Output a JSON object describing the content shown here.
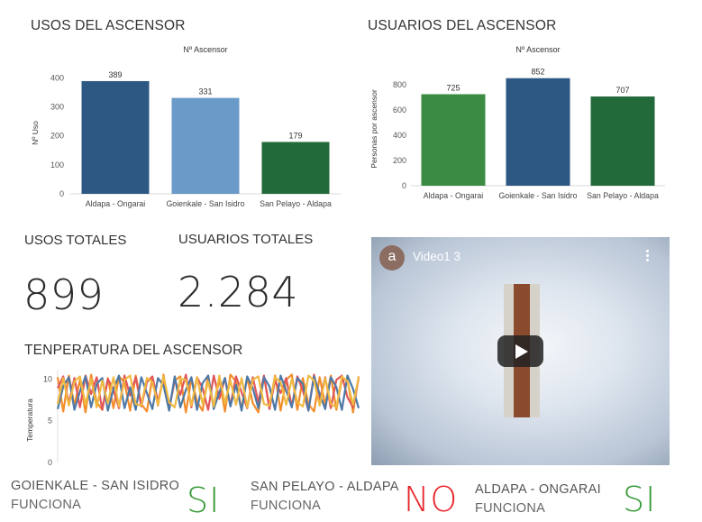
{
  "usos_chart": {
    "title": "USOS DEL ASCENSOR",
    "chart_data": {
      "type": "bar",
      "legend_title": "Nº Ascensor",
      "ylabel": "Nº Uso",
      "xlabel": "",
      "categories": [
        "Aldapa - Ongarai",
        "Goienkale - San Isidro",
        "San Pelayo - Aldapa"
      ],
      "values": [
        389,
        331,
        179
      ],
      "colors": [
        "#2d5883",
        "#6a9bc8",
        "#236a3a"
      ],
      "yticks": [
        0,
        100,
        200,
        300,
        400
      ],
      "ylim": [
        0,
        420
      ],
      "grid": false
    }
  },
  "usuarios_chart": {
    "title": "USUARIOS DEL ASCENSOR",
    "chart_data": {
      "type": "bar",
      "legend_title": "Nº Ascensor",
      "ylabel": "Personas por ascensor",
      "xlabel": "",
      "categories": [
        "Aldapa - Ongarai",
        "Goienkale - San Isidro",
        "San Pelayo - Aldapa"
      ],
      "values": [
        725,
        852,
        707
      ],
      "colors": [
        "#3b8b45",
        "#2d5883",
        "#236a3a"
      ],
      "yticks": [
        0,
        200,
        400,
        600,
        800
      ],
      "ylim": [
        0,
        900
      ],
      "grid": false
    }
  },
  "kpis": {
    "usos_totales": {
      "label": "USOS TOTALES",
      "value": "899"
    },
    "usuarios_totales": {
      "label": "USUARIOS TOTALES",
      "value": "2.284"
    }
  },
  "temp_chart": {
    "title": "TENPERATURA DEL ASCENSOR",
    "chart_data": {
      "type": "line",
      "ylabel": "Temperatura",
      "yticks": [
        0,
        5,
        10
      ],
      "ylim": [
        0,
        11
      ],
      "series": [
        {
          "color": "#f28e2b",
          "values": [
            10.2,
            6.1,
            10.4,
            6.8,
            9.9,
            6.0,
            10.5,
            7.2,
            6.3,
            10.1,
            6.5,
            10.3,
            9.6,
            6.2,
            10.4,
            7.0,
            6.1,
            10.2,
            6.8,
            10.5,
            6.4,
            9.8,
            10.3,
            6.0,
            10.1,
            7.3,
            6.2,
            10.4,
            6.6,
            10.0,
            6.1,
            10.5,
            9.7,
            6.4,
            10.2,
            7.1,
            6.0,
            10.3,
            6.7,
            10.4,
            6.2,
            9.9,
            10.5,
            6.3,
            10.1,
            7.0,
            6.1,
            10.2,
            6.9,
            10.4,
            6.3,
            10.0,
            9.8,
            6.0,
            10.3
          ]
        },
        {
          "color": "#e15759",
          "values": [
            8.9,
            10.3,
            7.1,
            10.1,
            6.6,
            10.4,
            8.2,
            10.2,
            6.3,
            10.0,
            8.7,
            6.5,
            10.4,
            8.0,
            10.2,
            6.7,
            9.6,
            10.3,
            7.3,
            10.1,
            6.4,
            9.9,
            8.1,
            10.5,
            6.6,
            10.2,
            8.9,
            6.3,
            10.4,
            7.6,
            10.1,
            6.8,
            10.3,
            8.4,
            6.5,
            10.2,
            7.2,
            10.4,
            6.4,
            9.8,
            8.3,
            10.1,
            6.7,
            10.3,
            8.6,
            6.2,
            10.5,
            7.4,
            10.2,
            6.5,
            9.9,
            10.4,
            7.8,
            6.6,
            10.1
          ]
        },
        {
          "color": "#4e79a7",
          "values": [
            6.4,
            9.1,
            10.2,
            6.3,
            8.5,
            10.3,
            6.6,
            9.4,
            10.1,
            6.2,
            8.8,
            10.4,
            6.5,
            9.0,
            6.3,
            10.2,
            8.3,
            6.4,
            10.1,
            9.2,
            6.2,
            10.3,
            6.6,
            8.7,
            10.2,
            6.3,
            9.5,
            10.4,
            6.4,
            8.4,
            10.1,
            6.7,
            9.3,
            6.2,
            10.3,
            8.9,
            6.5,
            10.2,
            9.1,
            6.3,
            10.4,
            8.6,
            6.6,
            10.1,
            9.4,
            6.2,
            10.3,
            8.2,
            6.4,
            10.2,
            9.0,
            6.3,
            10.4,
            8.8,
            6.5
          ]
        },
        {
          "color": "#f0b942",
          "values": [
            7.0,
            10.1,
            6.8,
            9.7,
            10.3,
            6.9,
            10.0,
            6.6,
            9.8,
            7.1,
            10.2,
            6.7,
            9.9,
            10.4,
            7.0,
            6.8,
            10.1,
            9.6,
            6.9,
            10.3,
            7.2,
            6.6,
            10.0,
            9.9,
            6.8,
            10.2,
            7.0,
            9.7,
            6.7,
            10.4,
            7.1,
            9.8,
            6.9,
            10.1,
            6.6,
            9.9,
            10.3,
            7.0,
            6.8,
            10.2,
            9.6,
            6.9,
            10.0,
            7.2,
            6.7,
            10.4,
            9.8,
            6.8,
            10.1,
            7.0,
            6.6,
            10.3,
            9.7,
            6.9,
            10.2
          ]
        }
      ]
    }
  },
  "video": {
    "avatar_letter": "a",
    "title": "Video1 3"
  },
  "status": [
    {
      "name": "GOIENKALE - SAN ISIDRO",
      "label": "FUNCIONA",
      "value": "SI",
      "color": "#3a9a3a"
    },
    {
      "name": "SAN PELAYO - ALDAPA",
      "label": "FUNCIONA",
      "value": "NO",
      "color": "#e8262b"
    },
    {
      "name": "ALDAPA - ONGARAI",
      "label": "FUNCIONA",
      "value": "SI",
      "color": "#3a9a3a"
    }
  ]
}
